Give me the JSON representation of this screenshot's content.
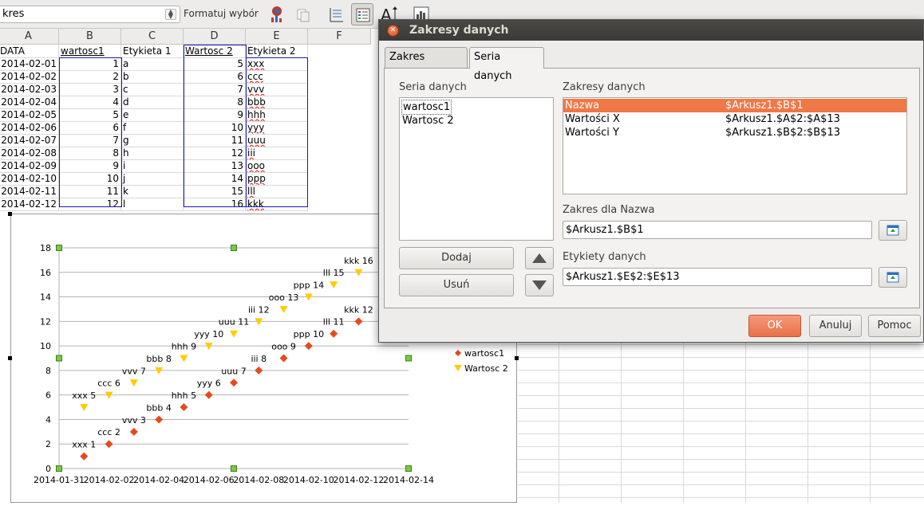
{
  "toolbar": {
    "name_box": "kres",
    "format_selection": "Formatuj wybór"
  },
  "sheet": {
    "columns": [
      "A",
      "B",
      "C",
      "D",
      "E",
      "F"
    ],
    "rows": [
      [
        "DATA",
        "wartosc1",
        "Etykieta 1",
        "Wartosc 2",
        "Etykieta 2"
      ],
      [
        "2014-02-01",
        "1",
        "a",
        "5",
        "xxx"
      ],
      [
        "2014-02-02",
        "2",
        "b",
        "6",
        "ccc"
      ],
      [
        "2014-02-03",
        "3",
        "c",
        "7",
        "vvv"
      ],
      [
        "2014-02-04",
        "4",
        "d",
        "8",
        "bbb"
      ],
      [
        "2014-02-05",
        "5",
        "e",
        "9",
        "hhh"
      ],
      [
        "2014-02-06",
        "6",
        "f",
        "10",
        "yyy"
      ],
      [
        "2014-02-07",
        "7",
        "g",
        "11",
        "uuu"
      ],
      [
        "2014-02-08",
        "8",
        "h",
        "12",
        "iii"
      ],
      [
        "2014-02-09",
        "9",
        "i",
        "13",
        "ooo"
      ],
      [
        "2014-02-10",
        "10",
        "j",
        "14",
        "ppp"
      ],
      [
        "2014-02-11",
        "11",
        "k",
        "15",
        "lll"
      ],
      [
        "2014-02-12",
        "12",
        "l",
        "16",
        "kkk"
      ]
    ]
  },
  "chart_data": {
    "type": "scatter",
    "title": "",
    "xlabel": "",
    "ylabel": "",
    "x_ticks": [
      "2014-01-31",
      "2014-02-02",
      "2014-02-04",
      "2014-02-06",
      "2014-02-08",
      "2014-02-10",
      "2014-02-12",
      "2014-02-14"
    ],
    "y_ticks": [
      "0",
      "2",
      "4",
      "6",
      "8",
      "10",
      "12",
      "14",
      "16",
      "18"
    ],
    "ylim": [
      0,
      18
    ],
    "xlim": [
      "2014-01-31",
      "2014-02-14"
    ],
    "grid": true,
    "legend": "right",
    "series": [
      {
        "name": "wartosc1",
        "color": "#e8491c",
        "marker": "diamond",
        "x": [
          "2014-02-01",
          "2014-02-02",
          "2014-02-03",
          "2014-02-04",
          "2014-02-05",
          "2014-02-06",
          "2014-02-07",
          "2014-02-08",
          "2014-02-09",
          "2014-02-10",
          "2014-02-11",
          "2014-02-12"
        ],
        "y": [
          1,
          2,
          3,
          4,
          5,
          6,
          7,
          8,
          9,
          10,
          11,
          12
        ],
        "labels": [
          "xxx 1",
          "ccc 2",
          "vvv 3",
          "bbb 4",
          "hhh 5",
          "yyy 6",
          "uuu 7",
          "iii 8",
          "ooo 9",
          "ppp 10",
          "lll 11",
          "kkk 12"
        ]
      },
      {
        "name": "Wartosc 2",
        "color": "#ffcc00",
        "marker": "triangle-down",
        "x": [
          "2014-02-01",
          "2014-02-02",
          "2014-02-03",
          "2014-02-04",
          "2014-02-05",
          "2014-02-06",
          "2014-02-07",
          "2014-02-08",
          "2014-02-09",
          "2014-02-10",
          "2014-02-11",
          "2014-02-12"
        ],
        "y": [
          5,
          6,
          7,
          8,
          9,
          10,
          11,
          12,
          13,
          14,
          15,
          16
        ],
        "labels": [
          "xxx 5",
          "ccc 6",
          "vvv 7",
          "bbb 8",
          "hhh 9",
          "yyy 10",
          "uuu 11",
          "iii 12",
          "ooo 13",
          "ppp 14",
          "lll 15",
          "kkk 16"
        ]
      }
    ]
  },
  "dialog": {
    "title": "Zakresy danych",
    "tabs": [
      "Zakres danych",
      "Seria danych"
    ],
    "series_label": "Seria danych",
    "series": [
      "wartosc1",
      "Wartosc 2"
    ],
    "ranges_label": "Zakresy danych",
    "ranges": [
      {
        "role": "Nazwa",
        "range": "$Arkusz1.$B$1"
      },
      {
        "role": "Wartości X",
        "range": "$Arkusz1.$A$2:$A$13"
      },
      {
        "role": "Wartości Y",
        "range": "$Arkusz1.$B$2:$B$13"
      }
    ],
    "range_for_label": "Zakres dla Nazwa",
    "range_for_value": "$Arkusz1.$B$1",
    "data_labels_label": "Etykiety danych",
    "data_labels_value": "$Arkusz1.$E$2:$E$13",
    "add_button": "Dodaj",
    "remove_button": "Usuń",
    "ok_button": "OK",
    "cancel_button": "Anuluj",
    "help_button": "Pomoc"
  }
}
